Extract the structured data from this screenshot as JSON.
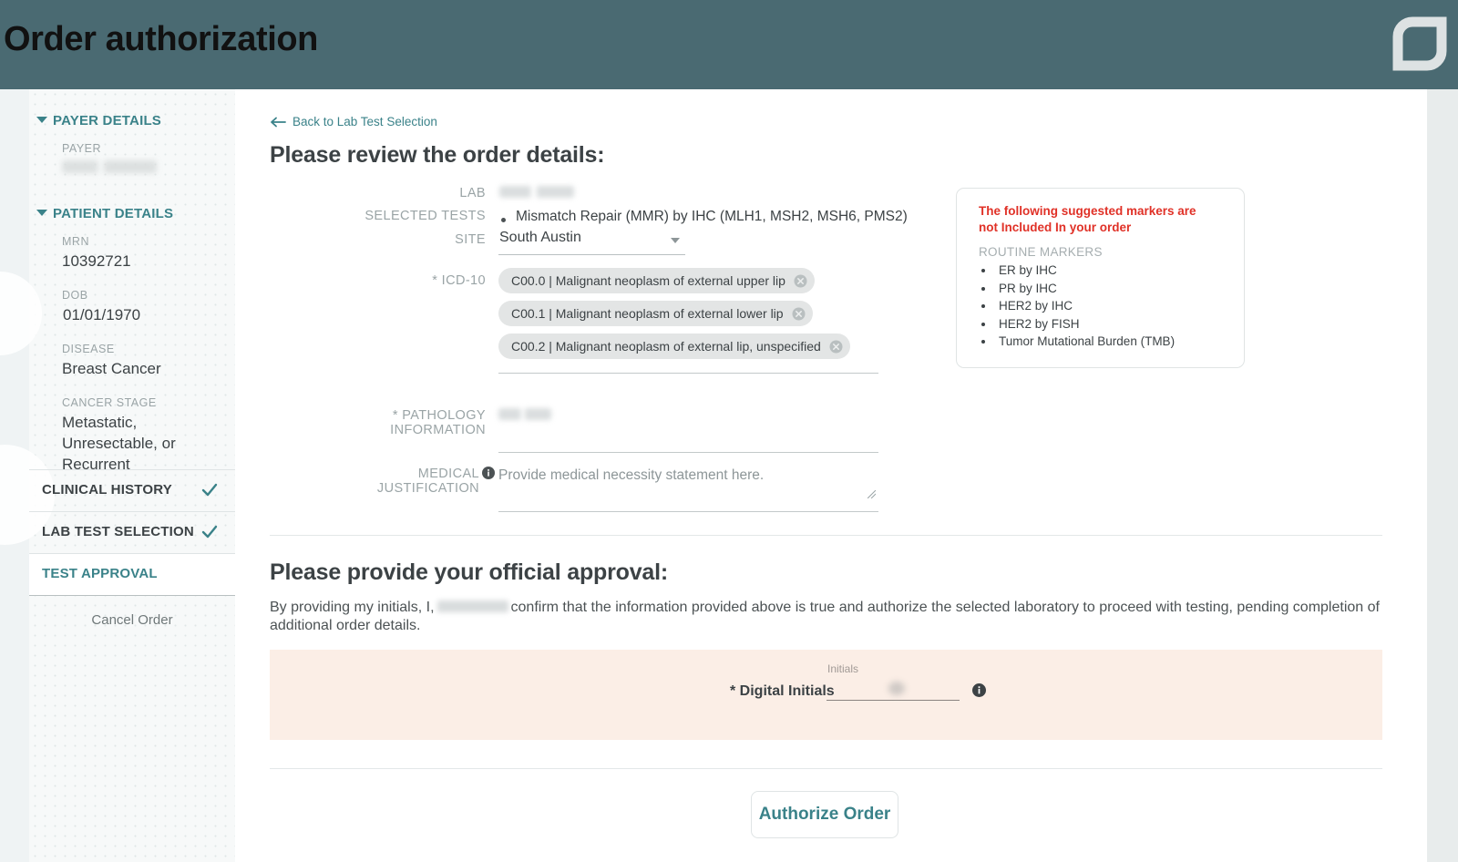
{
  "header": {
    "title": "Order authorization",
    "logo_icon": "leaf-logo-icon",
    "bg_color": "#4a6a72"
  },
  "sidebar": {
    "payer_section": {
      "title": "PAYER DETAILS",
      "fields": [
        {
          "label": "PAYER",
          "value": "",
          "redacted": true
        }
      ]
    },
    "patient_section": {
      "title": "PATIENT DETAILS",
      "fields": [
        {
          "label": "MRN",
          "value": "10392721"
        },
        {
          "label": "DOB",
          "value": "01/01/1970"
        },
        {
          "label": "DISEASE",
          "value": "Breast Cancer"
        },
        {
          "label": "CANCER STAGE",
          "value": "Metastatic, Unresectable, or Recurrent"
        }
      ]
    },
    "steps": [
      {
        "label": "CLINICAL HISTORY",
        "completed": true,
        "active": false
      },
      {
        "label": "LAB TEST SELECTION",
        "completed": true,
        "active": false
      },
      {
        "label": "TEST APPROVAL",
        "completed": false,
        "active": true
      }
    ],
    "cancel_label": "Cancel Order",
    "accent_color": "#3a8289"
  },
  "main": {
    "back_link": "Back to Lab Test Selection",
    "review_heading": "Please review the order details:",
    "fields": {
      "lab_label": "LAB",
      "lab_value": "",
      "selected_tests_label": "SELECTED TESTS",
      "selected_tests": [
        "Mismatch Repair (MMR) by IHC (MLH1, MSH2, MSH6, PMS2)"
      ],
      "site_label": "SITE",
      "site_value": "South Austin",
      "icd10_label": "* ICD-10",
      "icd10_chips": [
        "C00.0 | Malignant neoplasm of external upper lip",
        "C00.1 | Malignant neoplasm of external lower lip",
        "C00.2 | Malignant neoplasm of external lip, unspecified"
      ],
      "pathology_label": "* PATHOLOGY INFORMATION",
      "pathology_value": "",
      "medical_justification_label": "MEDICAL JUSTIFICATION",
      "medical_justification_placeholder": "Provide medical necessity statement here."
    },
    "markers_card": {
      "title": "The following suggested markers are not Included In your order",
      "subtitle": "ROUTINE MARKERS",
      "items": [
        "ER by IHC",
        "PR by IHC",
        "HER2 by IHC",
        "HER2 by FISH",
        "Tumor Mutational Burden (TMB)"
      ],
      "title_color": "#e03127"
    },
    "approval": {
      "heading": "Please provide your official approval:",
      "text_before_name": "By providing my initials, I,",
      "text_after_name": "confirm that the information provided above is true and authorize the selected laboratory to proceed with testing, pending completion of additional order details.",
      "initials_caption": "Initials",
      "initials_label": "* Digital Initials",
      "initials_value": "",
      "panel_color": "#fbeee6"
    },
    "authorize_button": "Authorize Order"
  }
}
